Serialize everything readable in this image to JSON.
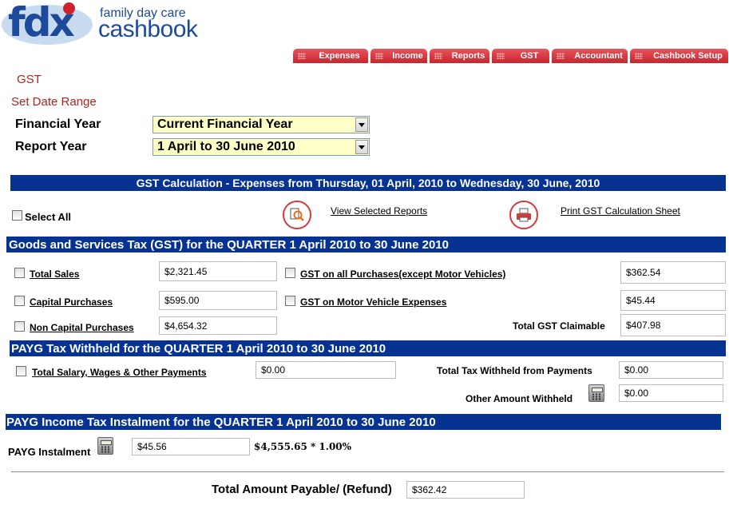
{
  "logo": {
    "mark": "fdx",
    "tagline": "family day care",
    "name": "cashbook"
  },
  "nav": [
    {
      "label": "Expenses"
    },
    {
      "label": "Income"
    },
    {
      "label": "Reports"
    },
    {
      "label": "GST"
    },
    {
      "label": "Accountant"
    },
    {
      "label": "Cashbook Setup"
    }
  ],
  "page_title": "GST",
  "date_range_title": "Set Date Range",
  "financial_year": {
    "label": "Financial Year",
    "value": "Current Financial Year"
  },
  "report_year": {
    "label": "Report Year",
    "value": "1 April to 30 June 2010"
  },
  "calc_header": "GST Calculation - Expenses from Thursday, 01 April, 2010 to Wednesday, 30 June, 2010",
  "select_all": "Select All",
  "actions": {
    "view_reports": "View Selected Reports",
    "print_sheet": "Print GST Calculation Sheet"
  },
  "gst_section": {
    "header": "Goods and Services Tax (GST) for the QUARTER 1 April 2010 to 30 June 2010",
    "total_sales": {
      "label": "Total Sales",
      "value": "$2,321.45"
    },
    "capital_purchases": {
      "label": "Capital Purchases",
      "value": "$595.00"
    },
    "non_capital_purchases": {
      "label": "Non Capital Purchases",
      "value": "$4,654.32"
    },
    "gst_all_purchases": {
      "label": "GST on all Purchases(except Motor Vehicles)",
      "value": "$362.54"
    },
    "gst_motor": {
      "label": "GST on Motor Vehicle Expenses",
      "value": "$45.44"
    },
    "total_claimable": {
      "label": "Total GST Claimable",
      "value": "$407.98"
    }
  },
  "payg_withheld": {
    "header": "PAYG Tax Withheld for the QUARTER 1 April 2010 to 30 June 2010",
    "total_salary": {
      "label": "Total Salary, Wages & Other Payments",
      "value": "$0.00"
    },
    "total_withheld": {
      "label": "Total Tax Withheld from Payments",
      "value": "$0.00"
    },
    "other_withheld": {
      "label": "Other Amount Withheld",
      "value": "$0.00"
    }
  },
  "payg_instalment": {
    "header": "PAYG Income Tax Instalment for the QUARTER 1 April 2010 to 30 June 2010",
    "label": "PAYG Instalment",
    "value": "$45.56",
    "formula": "$4,555.65 * 1.00%"
  },
  "total_payable": {
    "label": "Total Amount Payable/ (Refund)",
    "value": "$362.42"
  },
  "icons": {
    "calculator": "calculator-icon",
    "view": "magnifier-report-icon",
    "print": "printer-icon"
  },
  "colors": {
    "brand_blue": "#1d4a9a",
    "section_bar": "#063391",
    "nav_red": "#c8262e",
    "title_red": "#b22222",
    "select_bg": "#ffffc8"
  }
}
